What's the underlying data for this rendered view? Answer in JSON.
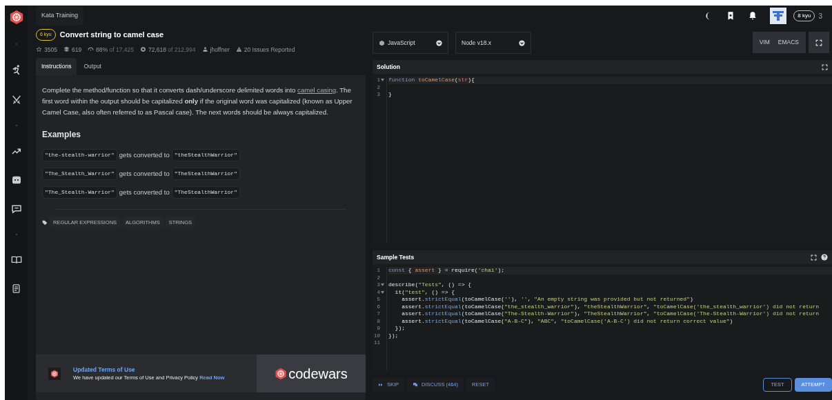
{
  "topbar": {
    "title": "Kata Training",
    "rank_badge": "8 kyu",
    "honor": "3"
  },
  "sidebar": {
    "items": [
      {
        "kind": "logo"
      },
      {
        "kind": "dot"
      },
      {
        "kind": "kata"
      },
      {
        "kind": "swords"
      },
      {
        "kind": "dot"
      },
      {
        "kind": "trend"
      },
      {
        "kind": "discord"
      },
      {
        "kind": "chat"
      },
      {
        "kind": "dot"
      },
      {
        "kind": "book"
      },
      {
        "kind": "docs"
      }
    ]
  },
  "kata": {
    "rank": "6 kyu",
    "title": "Convert string to camel case",
    "stats": [
      {
        "kind": "star",
        "text": "3505"
      },
      {
        "kind": "collections",
        "text": "619"
      },
      {
        "kind": "satisfaction",
        "text": "88%",
        "suffix": "of 17,425"
      },
      {
        "kind": "completed",
        "text": "72,618",
        "suffix": "of 212,994"
      },
      {
        "kind": "author",
        "text": "jhoffner"
      },
      {
        "kind": "issues",
        "text": "20 Issues Reported"
      }
    ],
    "tabs": [
      {
        "label": "Instructions",
        "selected": true
      },
      {
        "label": "Output",
        "selected": false
      }
    ],
    "description": "Complete the method/function so that it converts dash/underscore delimited words into",
    "link": "camel casing",
    "description_end": ". The first word within the output should be capitalized **only** if the original word was capitalized (known as Upper Camel Case, also often referred to as Pascal case). The next words should be always capitalized.",
    "examples_heading": "Examples",
    "examples": [
      {
        "input": "\"the-stealth-warrior\"",
        "middle": "gets converted to",
        "output": "\"theStealthWarrior\""
      },
      {
        "input": "\"The_Stealth_Warrior\"",
        "middle": "gets converted to",
        "output": "\"TheStealthWarrior\""
      },
      {
        "input": "\"The_Stealth-Warrior\"",
        "middle": "gets converted to",
        "output": "\"TheStealthWarrior\""
      }
    ],
    "tags": [
      "REGULAR EXPRESSIONS",
      "ALGORITHMS",
      "STRINGS"
    ]
  },
  "banner": {
    "title": "Updated Terms of Use",
    "text": "We have updated our Terms of Use and Privacy Policy",
    "link": "Read Now",
    "brand": "codewars"
  },
  "editor": {
    "language": "JavaScript",
    "runtime": "Node v18.x",
    "modes": [
      "VIM",
      "EMACS"
    ],
    "solution": {
      "title": "Solution",
      "lines": [
        {
          "number": "1",
          "fold": true,
          "tokens": [
            {
              "kind": "kw",
              "text": "function "
            },
            {
              "kind": "name",
              "text": "toCamelCase"
            },
            {
              "kind": "plain",
              "text": "("
            },
            {
              "kind": "param",
              "text": "str"
            },
            {
              "kind": "plain",
              "text": "){"
            }
          ]
        },
        {
          "number": "2",
          "fold": false
        },
        {
          "number": "3",
          "fold": false,
          "tokens": [
            {
              "kind": "plain",
              "text": "}"
            }
          ]
        }
      ]
    },
    "tests": {
      "title": "Sample Tests",
      "lines": [
        {
          "number": "1",
          "fold": false,
          "tokens": [
            {
              "kind": "kw",
              "text": "const"
            },
            {
              "kind": "plain",
              "text": " { "
            },
            {
              "kind": "name",
              "text": "assert"
            },
            {
              "kind": "plain",
              "text": " } = require("
            },
            {
              "kind": "str",
              "text": "'chai'"
            },
            {
              "kind": "plain",
              "text": ");"
            }
          ]
        },
        {
          "number": "2",
          "fold": false
        },
        {
          "number": "3",
          "fold": true,
          "tokens": [
            {
              "kind": "plain",
              "text": "describe("
            },
            {
              "kind": "str",
              "text": "\"Tests\""
            },
            {
              "kind": "plain",
              "text": ", () => {"
            }
          ]
        },
        {
          "number": "4",
          "fold": true,
          "tokens": [
            {
              "kind": "plain",
              "text": "  it("
            },
            {
              "kind": "str",
              "text": "\"test\""
            },
            {
              "kind": "plain",
              "text": ", () => {"
            }
          ]
        },
        {
          "number": "5",
          "fold": false,
          "tokens": [
            {
              "kind": "plain",
              "text": "    assert."
            },
            {
              "kind": "fn",
              "text": "strictEqual"
            },
            {
              "kind": "plain",
              "text": "(toCamelCase("
            },
            {
              "kind": "str",
              "text": "''"
            },
            {
              "kind": "plain",
              "text": "), "
            },
            {
              "kind": "str",
              "text": "''"
            },
            {
              "kind": "plain",
              "text": ", "
            },
            {
              "kind": "str",
              "text": "\"An empty string was provided but not returned\""
            },
            {
              "kind": "plain",
              "text": ")"
            }
          ]
        },
        {
          "number": "6",
          "fold": false,
          "tokens": [
            {
              "kind": "plain",
              "text": "    assert."
            },
            {
              "kind": "fn",
              "text": "strictEqual"
            },
            {
              "kind": "plain",
              "text": "(toCamelCase("
            },
            {
              "kind": "str",
              "text": "\"the_stealth_warrior\""
            },
            {
              "kind": "plain",
              "text": "), "
            },
            {
              "kind": "str",
              "text": "\"theStealthWarrior\""
            },
            {
              "kind": "plain",
              "text": ", "
            },
            {
              "kind": "str",
              "text": "\"toCamelCase('the_stealth_warrior') did not return"
            }
          ]
        },
        {
          "number": "7",
          "fold": false,
          "tokens": [
            {
              "kind": "plain",
              "text": "    assert."
            },
            {
              "kind": "fn",
              "text": "strictEqual"
            },
            {
              "kind": "plain",
              "text": "(toCamelCase("
            },
            {
              "kind": "str",
              "text": "\"The-Stealth-Warrior\""
            },
            {
              "kind": "plain",
              "text": "), "
            },
            {
              "kind": "str",
              "text": "\"TheStealthWarrior\""
            },
            {
              "kind": "plain",
              "text": ", "
            },
            {
              "kind": "str",
              "text": "\"toCamelCase('The-Stealth-Warrior') did not return"
            }
          ]
        },
        {
          "number": "8",
          "fold": false,
          "tokens": [
            {
              "kind": "plain",
              "text": "    assert."
            },
            {
              "kind": "fn",
              "text": "strictEqual"
            },
            {
              "kind": "plain",
              "text": "(toCamelCase("
            },
            {
              "kind": "str",
              "text": "\"A-B-C\""
            },
            {
              "kind": "plain",
              "text": "), "
            },
            {
              "kind": "str",
              "text": "\"ABC\""
            },
            {
              "kind": "plain",
              "text": ", "
            },
            {
              "kind": "str",
              "text": "\"toCamelCase('A-B-C') did not return correct value\""
            },
            {
              "kind": "plain",
              "text": ")"
            }
          ]
        },
        {
          "number": "9",
          "fold": false,
          "tokens": [
            {
              "kind": "plain",
              "text": "  });"
            }
          ]
        },
        {
          "number": "10",
          "fold": false,
          "tokens": [
            {
              "kind": "plain",
              "text": "});"
            }
          ]
        },
        {
          "number": "11",
          "fold": false
        }
      ]
    },
    "actions": [
      {
        "kind": "skip",
        "label": "SKIP"
      },
      {
        "kind": "discuss",
        "label": "DISCUSS (464)"
      },
      {
        "kind": "plain",
        "label": "RESET"
      }
    ],
    "submit": [
      {
        "label": "TEST",
        "primary": false
      },
      {
        "label": "ATTEMPT",
        "primary": true
      }
    ]
  }
}
